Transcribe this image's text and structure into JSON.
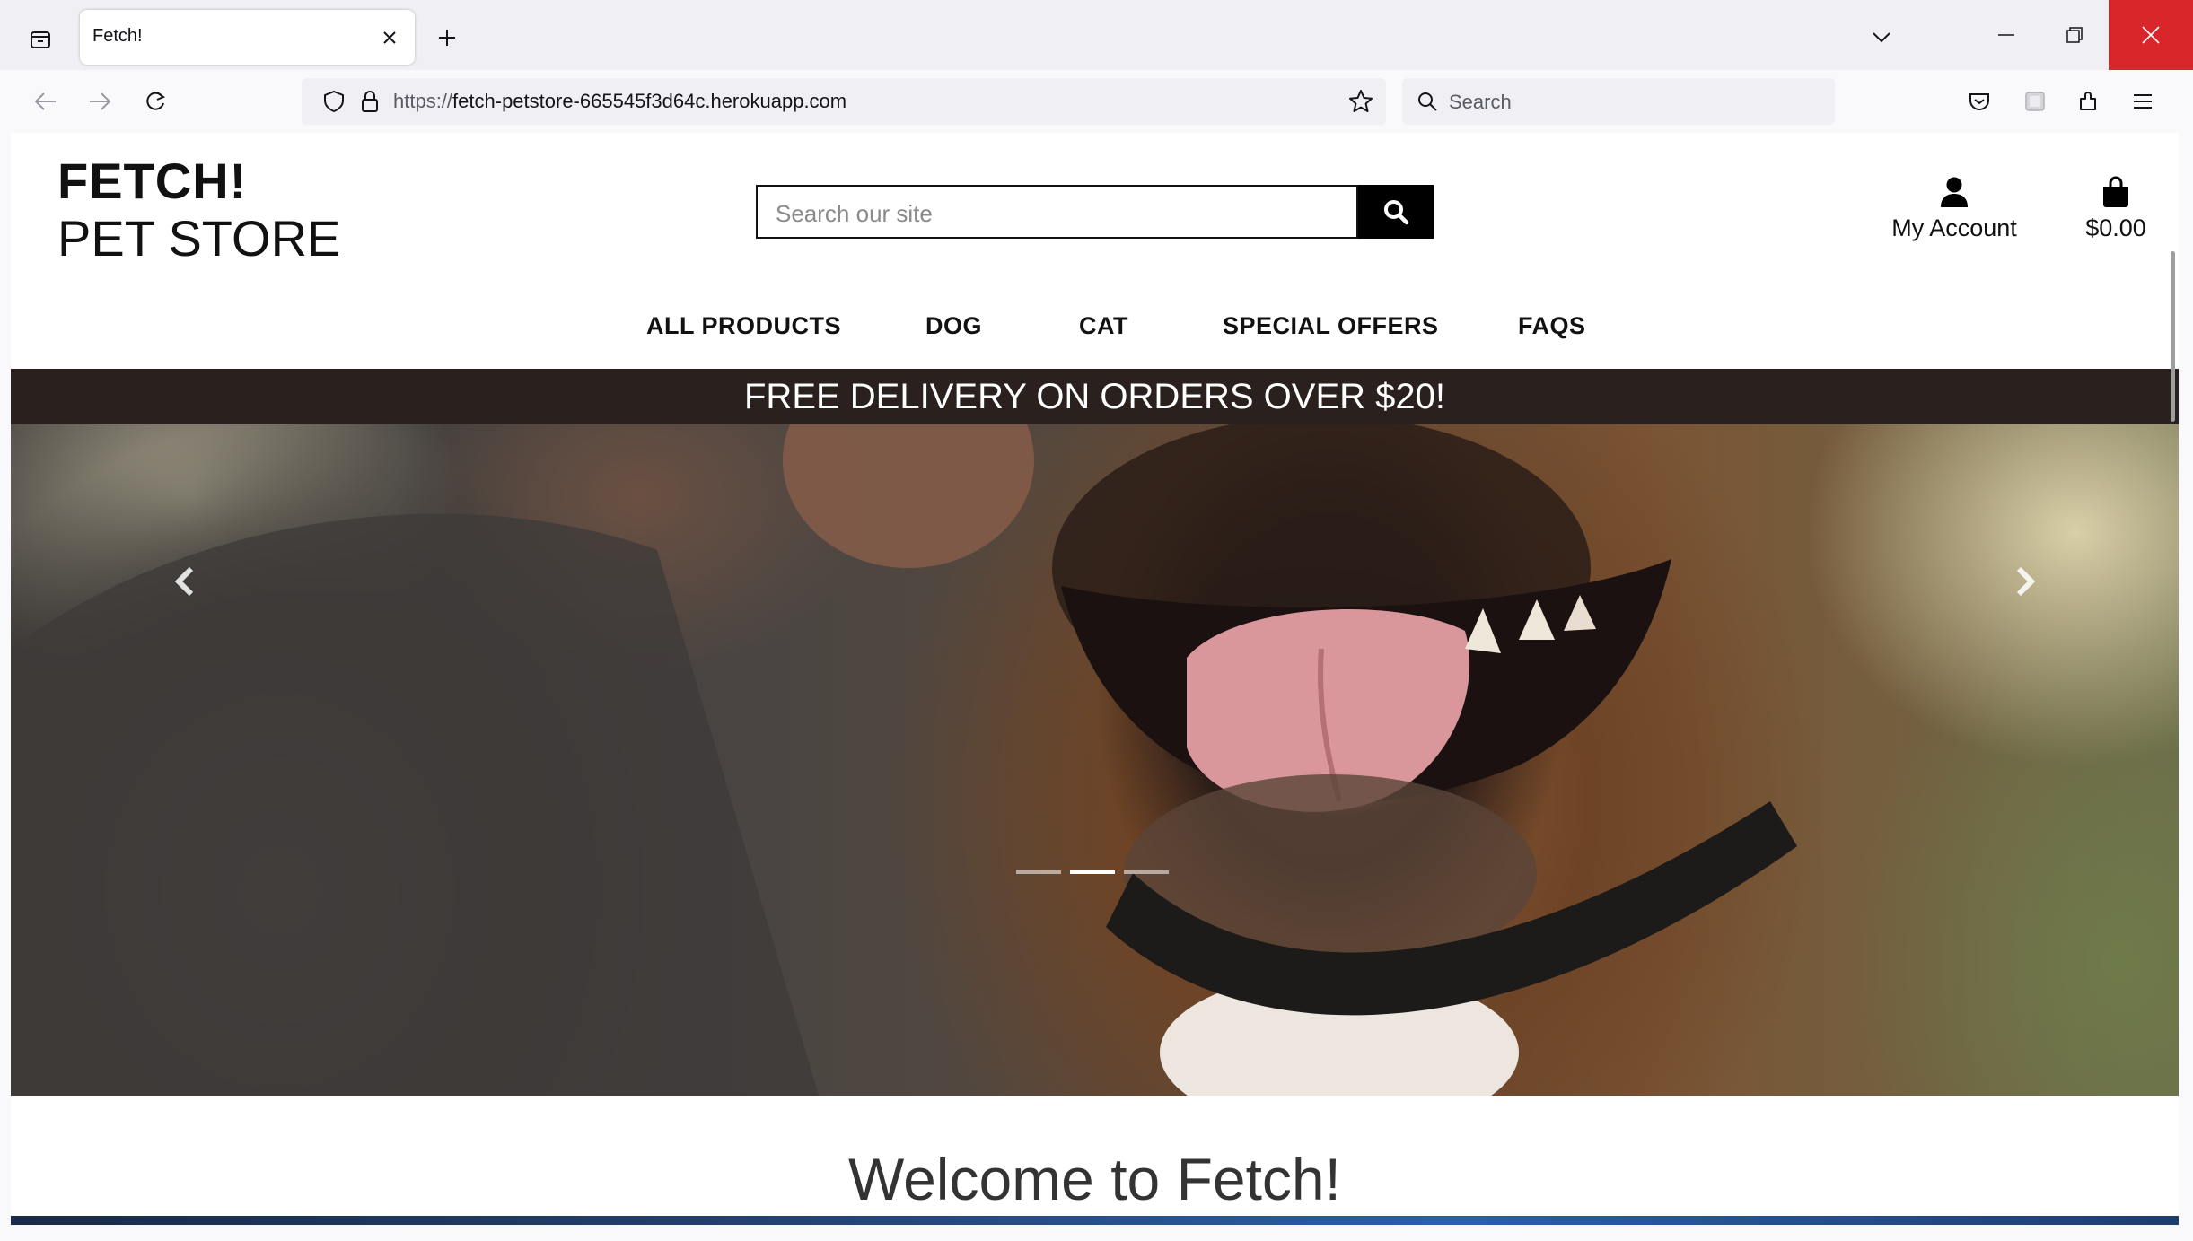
{
  "browser": {
    "tab_title": "Fetch!",
    "url_proto": "https://",
    "url_host": "fetch-petstore-665545f3d64c.herokuapp.com",
    "search_placeholder": "Search"
  },
  "header": {
    "logo_line1": "FETCH!",
    "logo_line2": "PET STORE",
    "search_placeholder": "Search our site",
    "account_label": "My Account",
    "bag_total": "$0.00"
  },
  "nav": {
    "items": [
      "ALL PRODUCTS",
      "DOG",
      "CAT",
      "SPECIAL OFFERS",
      "FAQS"
    ]
  },
  "banner": {
    "text": "FREE DELIVERY ON ORDERS OVER $20!"
  },
  "carousel": {
    "slide_count": 3,
    "active_index": 1
  },
  "main": {
    "welcome_heading": "Welcome to Fetch!"
  },
  "colors": {
    "banner_bg": "#2a211f",
    "close_button": "#d9262b"
  }
}
